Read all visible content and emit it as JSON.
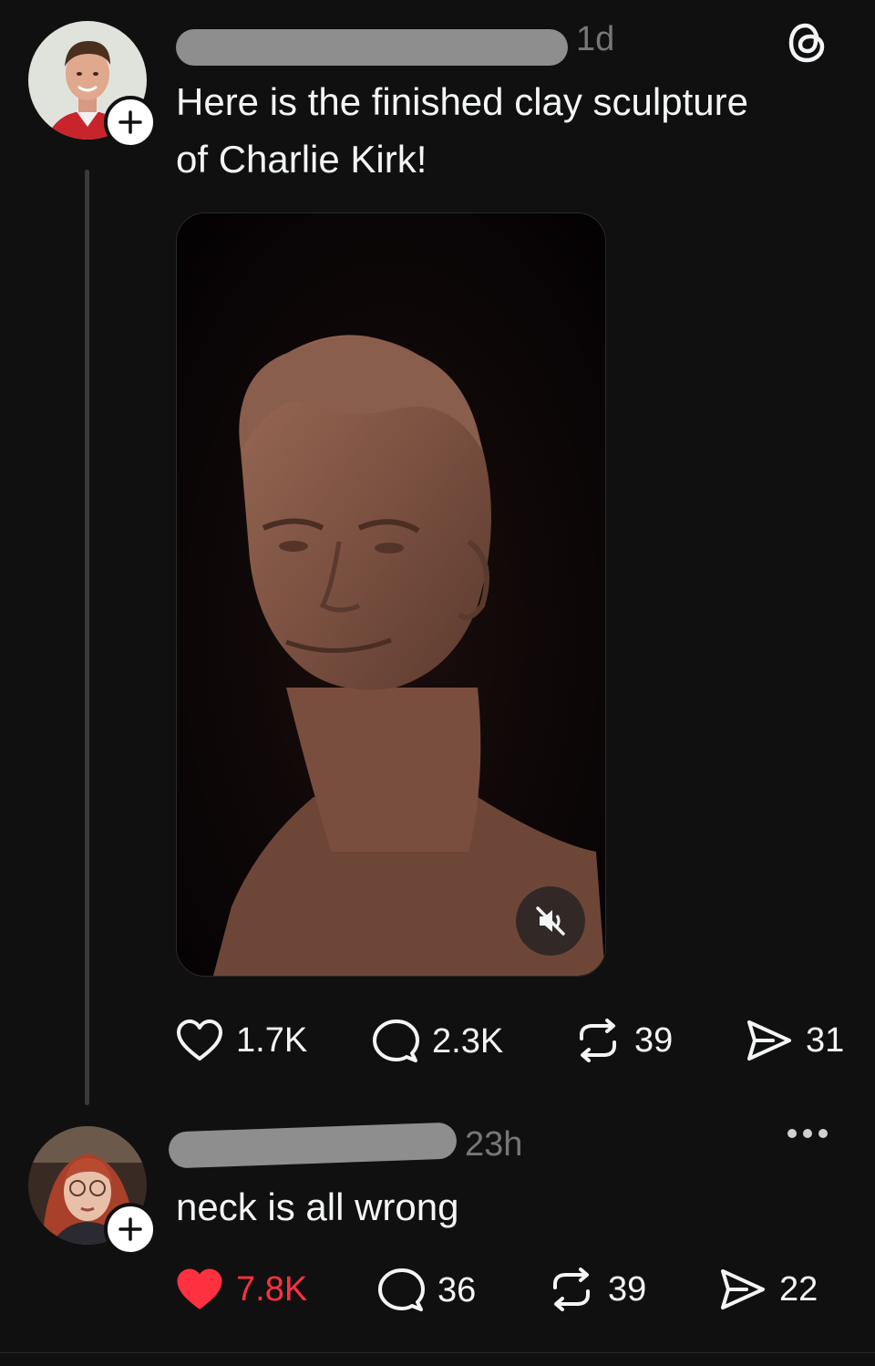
{
  "post": {
    "time": "1d",
    "text_line1": "Here is the finished clay sculpture",
    "text_line2": "of Charlie Kirk!",
    "actions": {
      "likes": "1.7K",
      "replies": "2.3K",
      "reposts": "39",
      "shares": "31"
    }
  },
  "reply": {
    "time": "23h",
    "text": "neck is all wrong",
    "actions": {
      "likes": "7.8K",
      "replies": "36",
      "reposts": "39",
      "shares": "22"
    }
  },
  "colors": {
    "background": "#101010",
    "like_active": "#ff3040",
    "secondary_text": "#777777",
    "clay": "#7a5040"
  }
}
